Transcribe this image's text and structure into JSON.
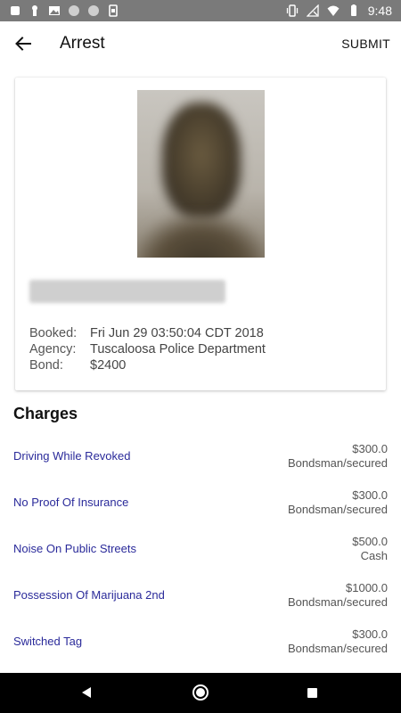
{
  "status_bar": {
    "time": "9:48",
    "left_icons": [
      "notification-icon",
      "alert-icon",
      "image-icon",
      "circle-icon",
      "circle-icon",
      "sim-icon"
    ],
    "right_icons": [
      "vibrate-icon",
      "no-signal-icon",
      "wifi-icon",
      "battery-icon"
    ]
  },
  "app_bar": {
    "title": "Arrest",
    "submit_label": "SUBMIT"
  },
  "arrest": {
    "booked_label": "Booked:",
    "booked_value": "Fri Jun 29 03:50:04 CDT 2018",
    "agency_label": "Agency:",
    "agency_value": "Tuscaloosa Police Department",
    "bond_label": "Bond:",
    "bond_value": "$2400"
  },
  "charges": {
    "heading": "Charges",
    "items": [
      {
        "name": "Driving While Revoked",
        "amount": "$300.0",
        "type": "Bondsman/secured"
      },
      {
        "name": "No Proof Of Insurance",
        "amount": "$300.0",
        "type": "Bondsman/secured"
      },
      {
        "name": "Noise On Public Streets",
        "amount": "$500.0",
        "type": "Cash"
      },
      {
        "name": "Possession Of Marijuana 2nd",
        "amount": "$1000.0",
        "type": "Bondsman/secured"
      },
      {
        "name": "Switched Tag",
        "amount": "$300.0",
        "type": "Bondsman/secured"
      }
    ]
  },
  "colors": {
    "status_bar": "#7a7a7a",
    "charge_link": "#2a2a9a",
    "nav_bar": "#000000"
  }
}
